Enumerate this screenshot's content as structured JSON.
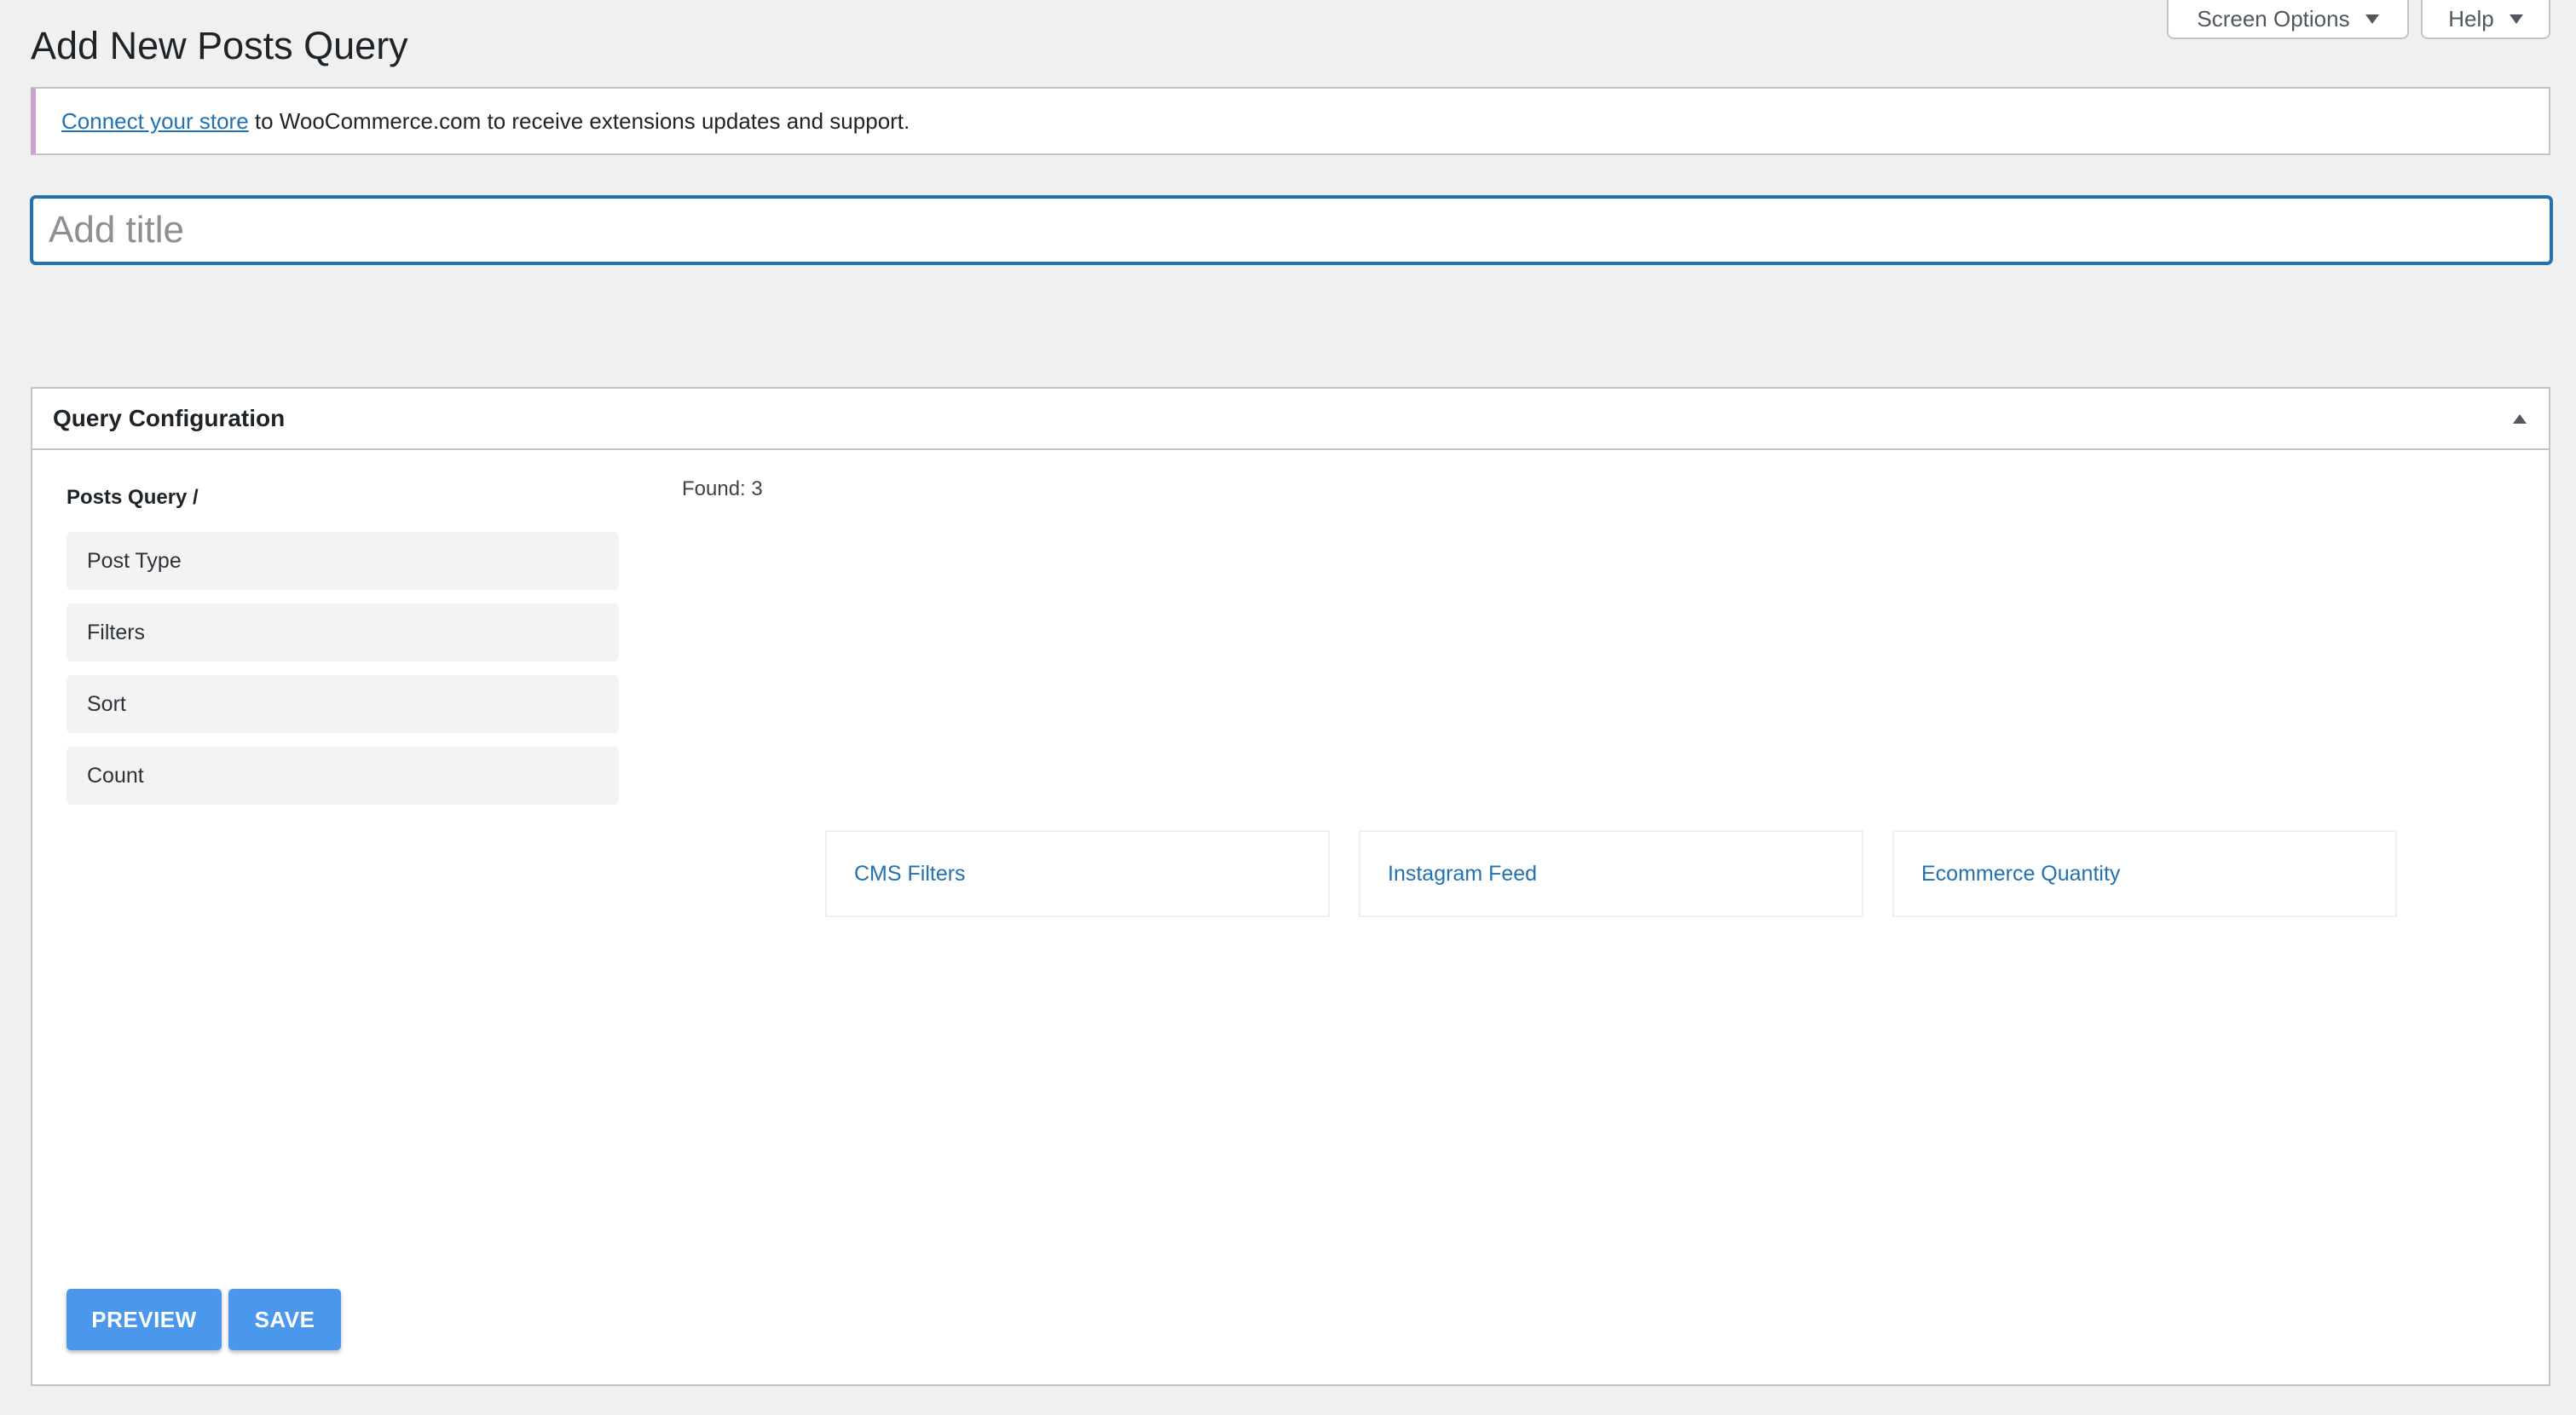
{
  "header": {
    "screen_options_label": "Screen Options",
    "help_label": "Help",
    "page_title": "Add New Posts Query"
  },
  "notice": {
    "link_text": "Connect your store",
    "text": " to WooCommerce.com to receive extensions updates and support."
  },
  "title_field": {
    "placeholder": "Add title",
    "value": ""
  },
  "query_box": {
    "heading": "Query Configuration",
    "breadcrumb": "Posts Query /",
    "menu": [
      {
        "label": "Post Type"
      },
      {
        "label": "Filters"
      },
      {
        "label": "Sort"
      },
      {
        "label": "Count"
      }
    ],
    "found_text": "Found: 3",
    "results": [
      {
        "label": "CMS Filters"
      },
      {
        "label": "Instagram Feed"
      },
      {
        "label": "Ecommerce Quantity"
      }
    ],
    "preview_label": "PREVIEW",
    "save_label": "SAVE"
  },
  "colors": {
    "accent": "#2271b1",
    "button": "#4b97ec",
    "notice_border": "#c9a3cc",
    "background": "#f0f0f1"
  }
}
